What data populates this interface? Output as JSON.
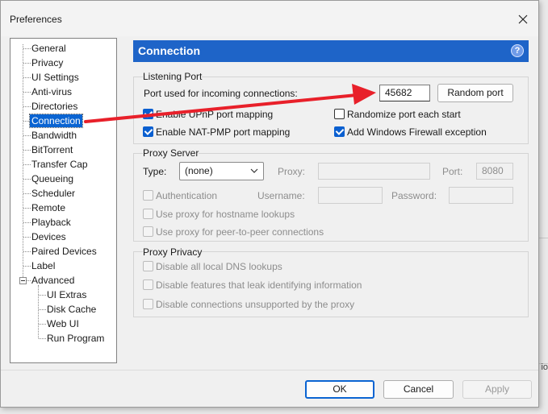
{
  "dialog": {
    "title": "Preferences"
  },
  "background": {
    "partial_text": "io"
  },
  "tree": {
    "items": [
      "General",
      "Privacy",
      "UI Settings",
      "Anti-virus",
      "Directories",
      "Connection",
      "Bandwidth",
      "BitTorrent",
      "Transfer Cap",
      "Queueing",
      "Scheduler",
      "Remote",
      "Playback",
      "Devices",
      "Paired Devices",
      "Label",
      "Advanced"
    ],
    "selected": "Connection",
    "advanced_children": [
      "UI Extras",
      "Disk Cache",
      "Web UI",
      "Run Program"
    ]
  },
  "panel": {
    "title": "Connection",
    "help_glyph": "?",
    "listening_port": {
      "group_label": "Listening Port",
      "port_label": "Port used for incoming connections:",
      "port_value": "45682",
      "random_button": "Random port",
      "upnp": {
        "label": "Enable UPnP port mapping",
        "checked": true
      },
      "natpmp": {
        "label": "Enable NAT-PMP port mapping",
        "checked": true
      },
      "randomize": {
        "label": "Randomize port each start",
        "checked": false
      },
      "firewall": {
        "label": "Add Windows Firewall exception",
        "checked": true
      }
    },
    "proxy_server": {
      "group_label": "Proxy Server",
      "type_label": "Type:",
      "type_value": "(none)",
      "proxy_label": "Proxy:",
      "port_label": "Port:",
      "port_value": "8080",
      "auth_label": "Authentication",
      "username_label": "Username:",
      "password_label": "Password:",
      "hostname_lookups": "Use proxy for hostname lookups",
      "p2p": "Use proxy for peer-to-peer connections"
    },
    "proxy_privacy": {
      "group_label": "Proxy Privacy",
      "dns": "Disable all local DNS lookups",
      "leak": "Disable features that leak identifying information",
      "unsupported": "Disable connections unsupported by the proxy"
    }
  },
  "footer": {
    "ok": "OK",
    "cancel": "Cancel",
    "apply": "Apply"
  },
  "colors": {
    "accent": "#1e64c8",
    "selection": "#0a64d2",
    "arrow": "#e8202a"
  }
}
